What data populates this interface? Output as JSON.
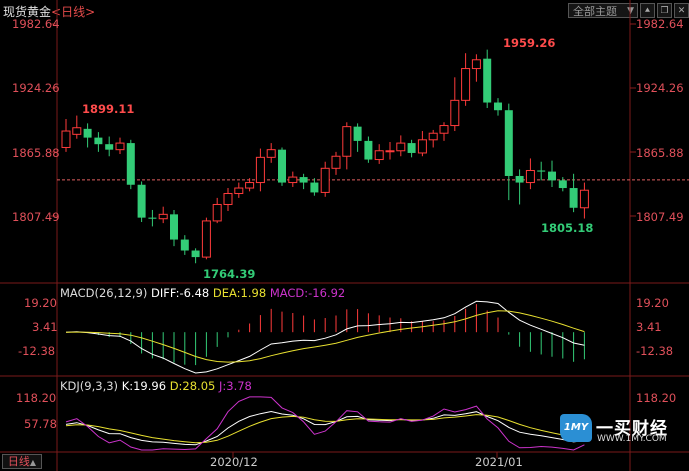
{
  "header": {
    "name": "现货黄金",
    "period_prefix": "<",
    "period": "日线",
    "period_suffix": ">"
  },
  "toolbar": {
    "theme_dropdown": "全部主题",
    "icons": [
      "dropdown-arrow-icon",
      "chevron-up-icon",
      "restore-icon",
      "close-icon"
    ]
  },
  "price_axis": {
    "labels": [
      "1982.64",
      "1924.26",
      "1865.88",
      "1807.49"
    ]
  },
  "annotations": {
    "high1": "1899.11",
    "high2": "1959.26",
    "low1": "1764.39",
    "low2": "1805.18"
  },
  "macd": {
    "title": "MACD(26,12,9)",
    "diff": "DIFF:-6.48",
    "dea": "DEA:1.98",
    "macd": "MACD:-16.92",
    "axis": [
      "19.20",
      "3.41",
      "-12.38"
    ]
  },
  "kdj": {
    "title": "KDJ(9,3,3)",
    "k": "K:19.96",
    "d": "D:28.05",
    "j": "J:3.78",
    "axis": [
      "118.20",
      "57.78"
    ]
  },
  "x_axis": {
    "labels": [
      "2020/12",
      "2021/01"
    ]
  },
  "period_tab": {
    "label": "日线",
    "arrow": "▲"
  },
  "watermark": {
    "mark": "1MY",
    "name": "一买财经",
    "url": "WWW.1MY.COM"
  },
  "colors": {
    "up": "#ff3b3b",
    "down": "#33cc77",
    "diff": "#ffffff",
    "dea": "#e8e030",
    "j": "#cc33cc",
    "axis": "#8a1d1d",
    "label": "#e0505a"
  },
  "chart_data": [
    {
      "type": "candlestick",
      "title": "现货黄金 日线",
      "ylim": [
        1760,
        1990
      ],
      "reference_line": 1840.5,
      "candles": [
        [
          1870,
          1885,
          1896,
          1866
        ],
        [
          1882,
          1888,
          1899.11,
          1878
        ],
        [
          1887,
          1879,
          1892,
          1870
        ],
        [
          1879,
          1873,
          1884,
          1866
        ],
        [
          1873,
          1868,
          1880,
          1862
        ],
        [
          1868,
          1874,
          1879,
          1864
        ],
        [
          1874,
          1836,
          1877,
          1832
        ],
        [
          1836,
          1806,
          1839,
          1802
        ],
        [
          1806,
          1805,
          1813,
          1798
        ],
        [
          1805,
          1809,
          1816,
          1801
        ],
        [
          1809,
          1786,
          1813,
          1780
        ],
        [
          1786,
          1776,
          1790,
          1772
        ],
        [
          1776,
          1770,
          1778,
          1764.39
        ],
        [
          1770,
          1803,
          1806,
          1768
        ],
        [
          1803,
          1818,
          1824,
          1801
        ],
        [
          1818,
          1828,
          1833,
          1812
        ],
        [
          1828,
          1833,
          1838,
          1824
        ],
        [
          1833,
          1838,
          1842,
          1830
        ],
        [
          1838,
          1861,
          1869,
          1830
        ],
        [
          1861,
          1868,
          1874,
          1856
        ],
        [
          1868,
          1838,
          1870,
          1835
        ],
        [
          1838,
          1843,
          1848,
          1834
        ],
        [
          1843,
          1838,
          1846,
          1832
        ],
        [
          1838,
          1829,
          1842,
          1826
        ],
        [
          1829,
          1851,
          1857,
          1825
        ],
        [
          1851,
          1862,
          1866,
          1845
        ],
        [
          1862,
          1889,
          1893,
          1850
        ],
        [
          1889,
          1876,
          1892,
          1866
        ],
        [
          1876,
          1859,
          1880,
          1856
        ],
        [
          1859,
          1867,
          1873,
          1855
        ],
        [
          1867,
          1867,
          1875,
          1859
        ],
        [
          1867,
          1874,
          1881,
          1862
        ],
        [
          1874,
          1865,
          1877,
          1861
        ],
        [
          1865,
          1877,
          1885,
          1862
        ],
        [
          1877,
          1883,
          1886,
          1870
        ],
        [
          1883,
          1890,
          1893,
          1876
        ],
        [
          1890,
          1913,
          1934,
          1885
        ],
        [
          1913,
          1942,
          1956,
          1908
        ],
        [
          1942,
          1950,
          1955,
          1930
        ],
        [
          1951,
          1911,
          1959.26,
          1906
        ],
        [
          1911,
          1904,
          1915,
          1899
        ],
        [
          1904,
          1844,
          1910,
          1822
        ],
        [
          1844,
          1838,
          1850,
          1818
        ],
        [
          1838,
          1849,
          1860,
          1832
        ],
        [
          1849,
          1848,
          1857,
          1840
        ],
        [
          1848,
          1840,
          1858,
          1834
        ],
        [
          1840,
          1833,
          1843,
          1830
        ],
        [
          1833,
          1815,
          1846,
          1811
        ],
        [
          1815,
          1831,
          1838,
          1805.18
        ]
      ]
    },
    {
      "type": "line",
      "title": "MACD(26,12,9)",
      "ylim": [
        -20,
        26
      ],
      "series": [
        {
          "name": "DIFF",
          "values": [
            -6.48
          ]
        },
        {
          "name": "DEA",
          "values": [
            1.98
          ]
        },
        {
          "name": "MACD",
          "values": [
            -16.92
          ]
        }
      ]
    },
    {
      "type": "line",
      "title": "KDJ(9,3,3)",
      "ylim": [
        -10,
        130
      ],
      "series": [
        {
          "name": "K",
          "values": [
            19.96
          ]
        },
        {
          "name": "D",
          "values": [
            28.05
          ]
        },
        {
          "name": "J",
          "values": [
            3.78
          ]
        }
      ]
    }
  ]
}
